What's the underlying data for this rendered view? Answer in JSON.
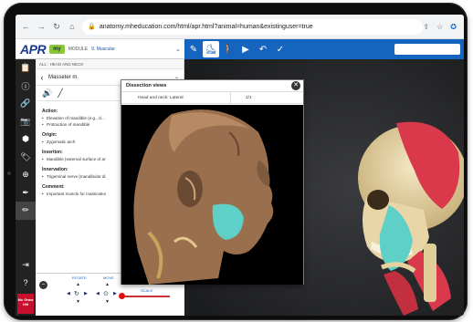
{
  "browser": {
    "url": "anatomy.mheducation.com/html/apr.html?animal=human&existinguser=true"
  },
  "app": {
    "logo": "APR",
    "badge": "my",
    "module_label": "MODULE",
    "module_value": "9. Muscular"
  },
  "breadcrumb": "ALL : HEAD AND NECK",
  "structure": {
    "name": "Masseter m."
  },
  "info": {
    "action_title": "Action:",
    "action_items": [
      "Elevation of mandible (e.g., cl...",
      "Protraction of mandible"
    ],
    "origin_title": "Origin:",
    "origin_items": [
      "Zygomatic arch"
    ],
    "insertion_title": "Insertion:",
    "insertion_items": [
      "Mandible (external surface of an..."
    ],
    "innervation_title": "Innervation:",
    "innervation_items": [
      "Trigeminal nerve (mandibular di..."
    ],
    "comment_title": "Comment:",
    "comment_items": [
      "Important muscle for mastication"
    ]
  },
  "controls": {
    "rotate_label": "ROTATE",
    "move_label": "MOVE",
    "select_view": "Select View",
    "scale_label": "SCALE",
    "scale_level": 0.05
  },
  "dissection": {
    "title": "Dissection views",
    "view_label": "Head and neck: Lateral",
    "view_count": "1/1"
  },
  "brand": {
    "publisher": "Mc Graw Hill",
    "accent": "#1565c0",
    "badge_color": "#8bc53f",
    "muscle_color": "#d9394a",
    "highlight_color": "#5ed0c8"
  }
}
